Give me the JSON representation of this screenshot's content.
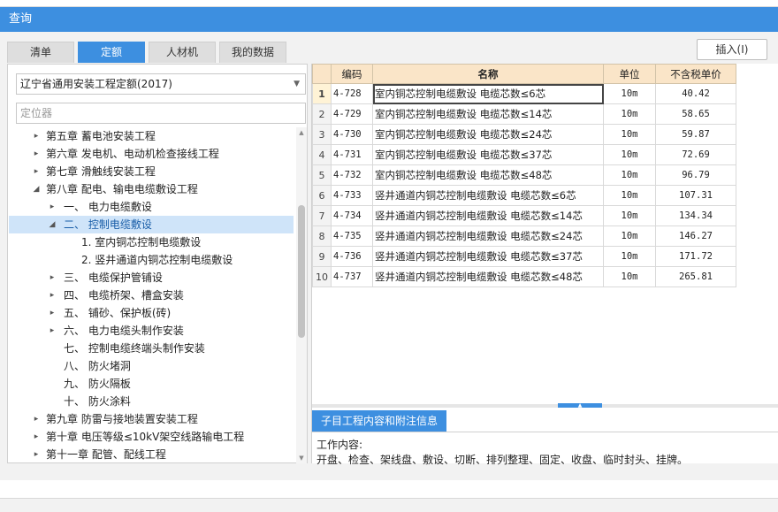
{
  "window": {
    "title": "查询"
  },
  "tabs": [
    {
      "label": "清单",
      "active": false
    },
    {
      "label": "定额",
      "active": true
    },
    {
      "label": "人材机",
      "active": false
    },
    {
      "label": "我的数据",
      "active": false
    }
  ],
  "toolbar": {
    "insert_label": "插入(I)"
  },
  "left": {
    "dropdown_value": "辽宁省通用安装工程定额(2017)",
    "locator_placeholder": "定位器",
    "tree": [
      {
        "label": "第五章 蓄电池安装工程",
        "level": 1,
        "arrow": "▸",
        "selected": false
      },
      {
        "label": "第六章 发电机、电动机检查接线工程",
        "level": 1,
        "arrow": "▸",
        "selected": false
      },
      {
        "label": "第七章 滑触线安装工程",
        "level": 1,
        "arrow": "▸",
        "selected": false
      },
      {
        "label": "第八章 配电、输电电缆敷设工程",
        "level": 1,
        "arrow": "◢",
        "selected": false
      },
      {
        "label": "一、 电力电缆敷设",
        "level": 2,
        "arrow": "▸",
        "selected": false
      },
      {
        "label": "二、 控制电缆敷设",
        "level": 2,
        "arrow": "◢",
        "selected": true
      },
      {
        "label": "1. 室内铜芯控制电缆敷设",
        "level": 3,
        "arrow": "",
        "selected": false
      },
      {
        "label": "2. 竖井通道内铜芯控制电缆敷设",
        "level": 3,
        "arrow": "",
        "selected": false
      },
      {
        "label": "三、 电缆保护管铺设",
        "level": 2,
        "arrow": "▸",
        "selected": false
      },
      {
        "label": "四、 电缆桥架、槽盒安装",
        "level": 2,
        "arrow": "▸",
        "selected": false
      },
      {
        "label": "五、 铺砂、保护板(砖)",
        "level": 2,
        "arrow": "▸",
        "selected": false
      },
      {
        "label": "六、 电力电缆头制作安装",
        "level": 2,
        "arrow": "▸",
        "selected": false
      },
      {
        "label": "七、 控制电缆终端头制作安装",
        "level": 2,
        "arrow": "",
        "selected": false
      },
      {
        "label": "八、 防火堵洞",
        "level": 2,
        "arrow": "",
        "selected": false
      },
      {
        "label": "九、 防火隔板",
        "level": 2,
        "arrow": "",
        "selected": false
      },
      {
        "label": "十、 防火涂料",
        "level": 2,
        "arrow": "",
        "selected": false
      },
      {
        "label": "第九章 防雷与接地装置安装工程",
        "level": 1,
        "arrow": "▸",
        "selected": false
      },
      {
        "label": "第十章 电压等级≤10kV架空线路输电工程",
        "level": 1,
        "arrow": "▸",
        "selected": false
      },
      {
        "label": "第十一章 配管、配线工程",
        "level": 1,
        "arrow": "▸",
        "selected": false
      }
    ]
  },
  "grid": {
    "headers": {
      "code": "编码",
      "name": "名称",
      "unit": "单位",
      "price": "不含税单价"
    },
    "rows": [
      {
        "no": "1",
        "code": "4-728",
        "name": "室内铜芯控制电缆敷设 电缆芯数≤6芯",
        "unit": "10m",
        "price": "40.42"
      },
      {
        "no": "2",
        "code": "4-729",
        "name": "室内铜芯控制电缆敷设 电缆芯数≤14芯",
        "unit": "10m",
        "price": "58.65"
      },
      {
        "no": "3",
        "code": "4-730",
        "name": "室内铜芯控制电缆敷设 电缆芯数≤24芯",
        "unit": "10m",
        "price": "59.87"
      },
      {
        "no": "4",
        "code": "4-731",
        "name": "室内铜芯控制电缆敷设 电缆芯数≤37芯",
        "unit": "10m",
        "price": "72.69"
      },
      {
        "no": "5",
        "code": "4-732",
        "name": "室内铜芯控制电缆敷设 电缆芯数≤48芯",
        "unit": "10m",
        "price": "96.79"
      },
      {
        "no": "6",
        "code": "4-733",
        "name": "竖井通道内铜芯控制电缆敷设 电缆芯数≤6芯",
        "unit": "10m",
        "price": "107.31"
      },
      {
        "no": "7",
        "code": "4-734",
        "name": "竖井通道内铜芯控制电缆敷设 电缆芯数≤14芯",
        "unit": "10m",
        "price": "134.34"
      },
      {
        "no": "8",
        "code": "4-735",
        "name": "竖井通道内铜芯控制电缆敷设 电缆芯数≤24芯",
        "unit": "10m",
        "price": "146.27"
      },
      {
        "no": "9",
        "code": "4-736",
        "name": "竖井通道内铜芯控制电缆敷设 电缆芯数≤37芯",
        "unit": "10m",
        "price": "171.72"
      },
      {
        "no": "10",
        "code": "4-737",
        "name": "竖井通道内铜芯控制电缆敷设 电缆芯数≤48芯",
        "unit": "10m",
        "price": "265.81"
      }
    ]
  },
  "info": {
    "tab_label": "子目工程内容和附注信息",
    "title": "工作内容:",
    "content": "开盘、检查、架线盘、敷设、切断、排列整理、固定、收盘、临时封头、挂牌。"
  },
  "colors": {
    "accent": "#3d8fe0",
    "header_bg": "#fae5c8",
    "selected_bg": "#cfe4f9"
  }
}
